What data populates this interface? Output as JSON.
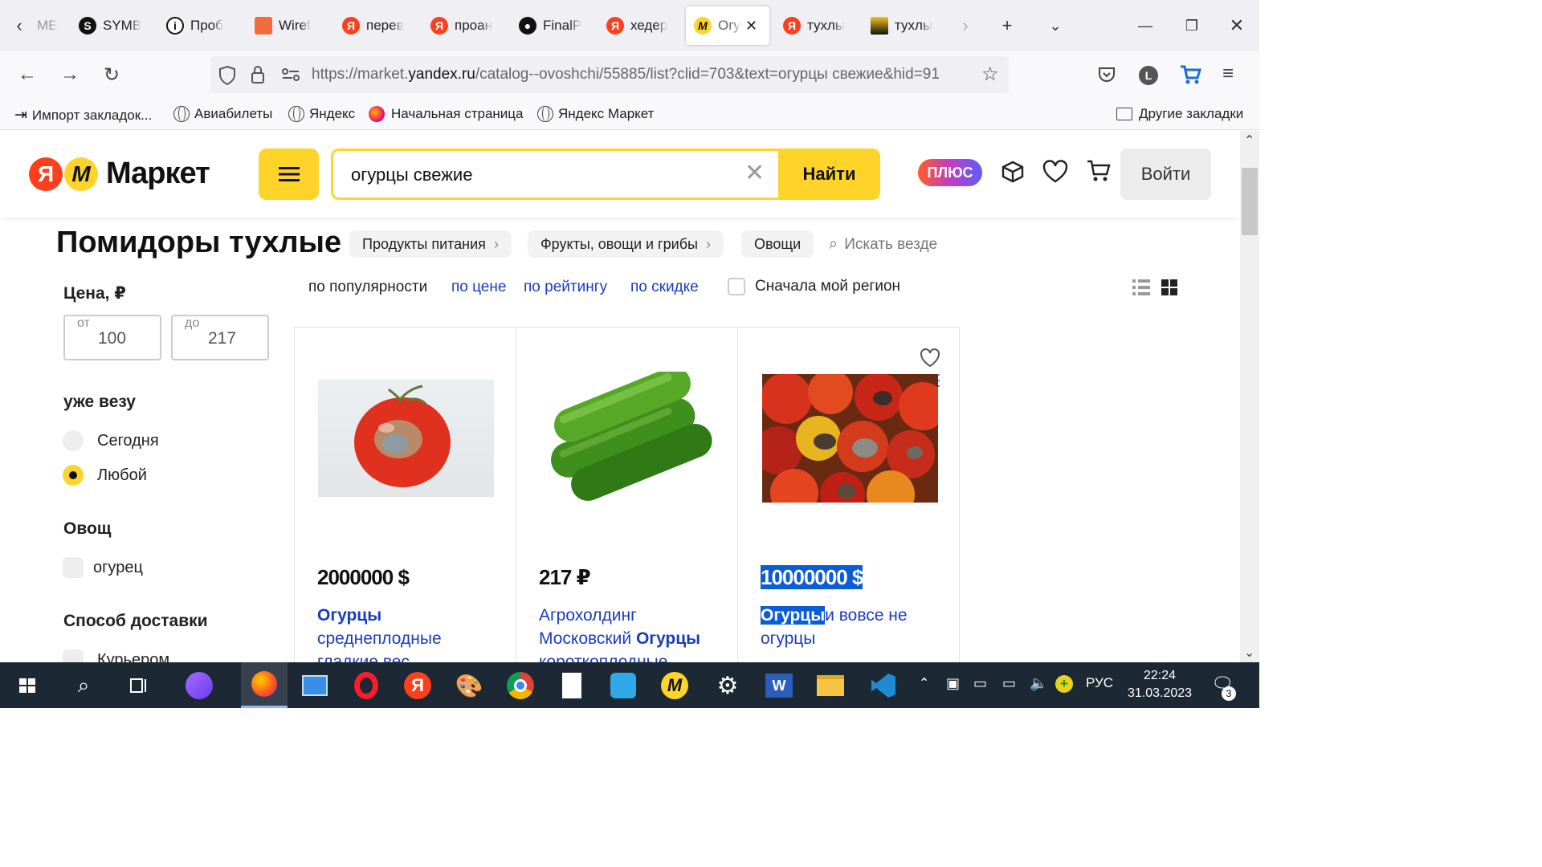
{
  "browser": {
    "tabs": [
      {
        "label": "ME",
        "icon": "partial-icon"
      },
      {
        "label": "SYMB",
        "icon": "symbol-icon"
      },
      {
        "label": "Проб",
        "icon": "info-icon"
      },
      {
        "label": "Wiref",
        "icon": "wireframe-icon"
      },
      {
        "label": "перев",
        "icon": "yandex-icon"
      },
      {
        "label": "проан",
        "icon": "yandex-icon"
      },
      {
        "label": "FinalP",
        "icon": "github-icon"
      },
      {
        "label": "хедер",
        "icon": "yandex-icon"
      },
      {
        "label": "Огу",
        "icon": "market-icon",
        "active": true
      },
      {
        "label": "тухлы",
        "icon": "yandex-icon"
      },
      {
        "label": "тухлы",
        "icon": "image-icon"
      }
    ],
    "url_prefix": "https://market.",
    "url_domain": "yandex.ru",
    "url_rest": "/catalog--ovoshchi/55885/list?clid=703&text=огурцы свежие&hid=91",
    "bookmarks": [
      "Импорт закладок...",
      "Авиабилеты",
      "Яндекс",
      "Начальная страница",
      "Яндекс Маркет"
    ],
    "other_bookmarks": "Другие закладки",
    "profile_letter": "L"
  },
  "market": {
    "logo_text": "Маркет",
    "search_value": "огурцы свежие",
    "search_button": "Найти",
    "plus_badge": "ПЛЮС",
    "login_button": "Войти",
    "page_title": "Помидоры тухлые",
    "breadcrumbs": [
      "Продукты питания",
      "Фрукты, овощи и грибы",
      "Овощи"
    ],
    "search_everywhere": "Искать везде",
    "sort": {
      "popular": "по популярности",
      "price": "по цене",
      "rating": "по рейтингу",
      "discount": "по скидке",
      "region": "Сначала мой регион"
    },
    "filters": {
      "price_title": "Цена, ₽",
      "from_label": "от",
      "from_value": "100",
      "to_label": "до",
      "to_value": "217",
      "delivery_title": "уже везу",
      "today": "Сегодня",
      "any": "Любой",
      "veg_title": "Овощ",
      "cucumber": "огурец",
      "shipping_title": "Способ доставки",
      "courier": "Курьером"
    },
    "products": [
      {
        "price": "2000000 $",
        "title_bold": "Огурцы",
        "title_rest": "среднеплодные гладкие вес"
      },
      {
        "price": "217 ₽",
        "title_pre": "Агрохолдинг Московский",
        "title_bold": "Огурцы",
        "title_rest": "короткоплодные"
      },
      {
        "price": "10000000 $",
        "title_bold": "Огурцы",
        "title_rest": "и вовсе не огурцы"
      }
    ]
  },
  "taskbar": {
    "lang": "РУС",
    "time": "22:24",
    "date": "31.03.2023",
    "notifications": "3"
  },
  "colors": {
    "yandex_red": "#fc3f1d",
    "market_yellow": "#fed42b",
    "link_blue": "#1a3cbf",
    "selection": "#0b5dd7"
  }
}
